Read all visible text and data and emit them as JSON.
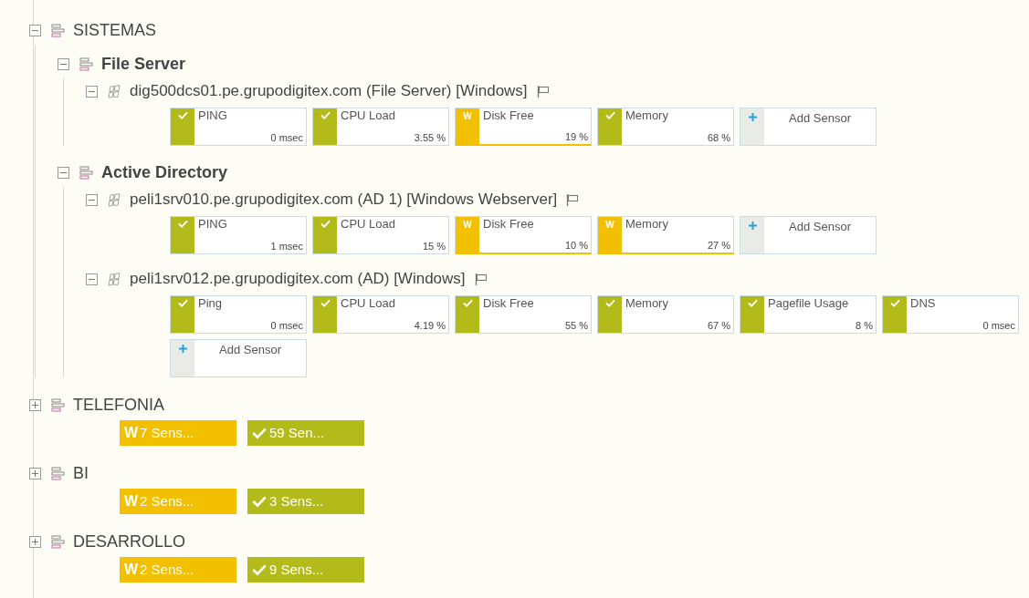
{
  "groups": [
    {
      "kind": "group",
      "name": "SISTEMAS",
      "expanded": true,
      "children": [
        {
          "kind": "group",
          "name": "File Server",
          "expanded": true,
          "children": [
            {
              "kind": "device",
              "name": "dig500dcs01.pe.grupodigitex.com (File Server) [Windows]",
              "expanded": true,
              "sensors": [
                {
                  "kind": "ok",
                  "name": "PING",
                  "value": "0 msec"
                },
                {
                  "kind": "ok",
                  "name": "CPU Load",
                  "value": "3.55 %"
                },
                {
                  "kind": "warning",
                  "badge": "W",
                  "name": "Disk Free",
                  "value": "19 %"
                },
                {
                  "kind": "ok",
                  "name": "Memory",
                  "value": "68 %"
                },
                {
                  "kind": "add",
                  "name": "Add Sensor"
                }
              ]
            }
          ]
        },
        {
          "kind": "group",
          "name": "Active Directory",
          "expanded": true,
          "children": [
            {
              "kind": "device",
              "name": "peli1srv010.pe.grupodigitex.com (AD 1) [Windows Webserver]",
              "expanded": true,
              "sensors": [
                {
                  "kind": "ok",
                  "name": "PING",
                  "value": "1 msec"
                },
                {
                  "kind": "ok",
                  "name": "CPU Load",
                  "value": "15 %"
                },
                {
                  "kind": "warning",
                  "badge": "W",
                  "name": "Disk Free",
                  "value": "10 %"
                },
                {
                  "kind": "warning",
                  "badge": "W",
                  "name": "Memory",
                  "value": "27 %"
                },
                {
                  "kind": "add",
                  "name": "Add Sensor"
                }
              ]
            },
            {
              "kind": "device",
              "name": "peli1srv012.pe.grupodigitex.com (AD) [Windows]",
              "expanded": true,
              "sensors": [
                {
                  "kind": "ok",
                  "name": "Ping",
                  "value": "0 msec"
                },
                {
                  "kind": "ok",
                  "name": "CPU Load",
                  "value": "4.19 %"
                },
                {
                  "kind": "ok",
                  "name": "Disk Free",
                  "value": "55 %"
                },
                {
                  "kind": "ok",
                  "name": "Memory",
                  "value": "67 %"
                },
                {
                  "kind": "ok",
                  "name": "Pagefile Usage",
                  "value": "8 %"
                },
                {
                  "kind": "ok",
                  "name": "DNS",
                  "value": "0 msec"
                },
                {
                  "kind": "add",
                  "name": "Add Sensor"
                }
              ]
            }
          ]
        }
      ]
    },
    {
      "kind": "group",
      "name": "TELEFONIA",
      "expanded": false,
      "summary": [
        {
          "kind": "warning",
          "badge": "W",
          "text": "7 Sens..."
        },
        {
          "kind": "ok",
          "text": "59 Sen..."
        }
      ]
    },
    {
      "kind": "group",
      "name": "BI",
      "expanded": false,
      "summary": [
        {
          "kind": "warning",
          "badge": "W",
          "text": "2 Sens..."
        },
        {
          "kind": "ok",
          "text": "3 Sens..."
        }
      ]
    },
    {
      "kind": "group",
      "name": "DESARROLLO",
      "expanded": false,
      "summary": [
        {
          "kind": "warning",
          "badge": "W",
          "text": "2 Sens..."
        },
        {
          "kind": "ok",
          "text": "9 Sens..."
        }
      ]
    }
  ]
}
